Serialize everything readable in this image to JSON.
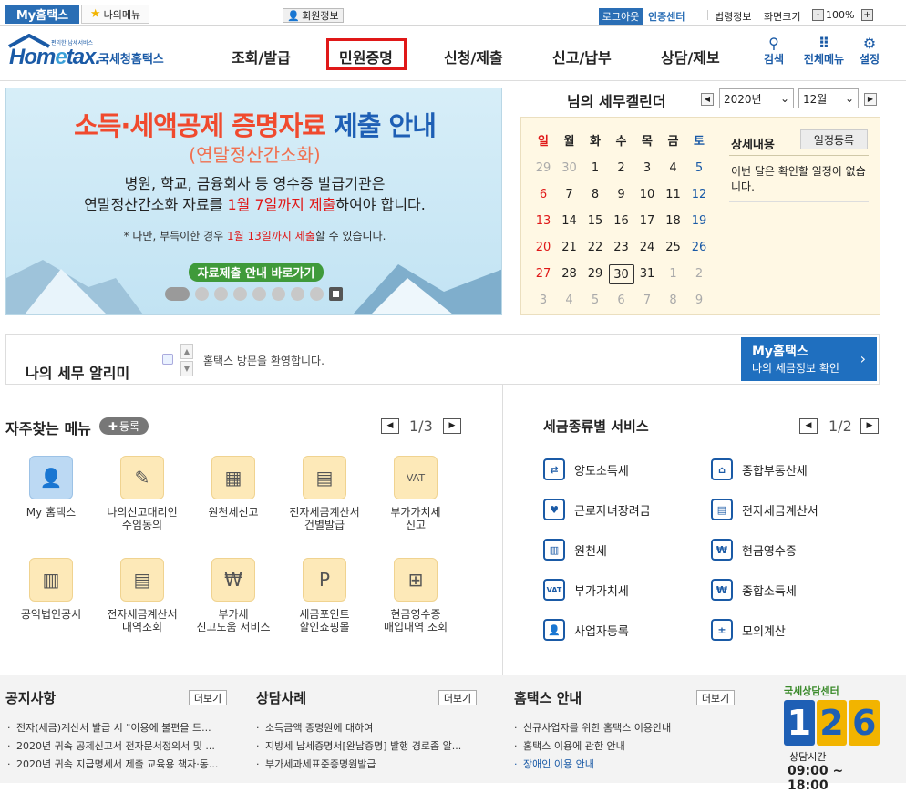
{
  "topbar": {
    "myhometax": "My홈택스",
    "mymenu": "나의메뉴",
    "member": "회원정보",
    "logout": "로그아웃",
    "cert": "인증센터",
    "law": "법령정보",
    "zoom_label": "화면크기",
    "zoom_minus": "-",
    "zoom_value": "100%",
    "zoom_plus": "+"
  },
  "header": {
    "logo_tiny": "편리한 납세서비스",
    "logo_brand_a": "Hom",
    "logo_brand_e": "e",
    "logo_brand_b": "tax.",
    "logo_sub": "국세청홈택스",
    "gnb": [
      "조회/발급",
      "민원증명",
      "신청/제출",
      "신고/납부",
      "상담/제보"
    ],
    "tools": [
      {
        "label": "검색",
        "icon": "search-icon"
      },
      {
        "label": "전체메뉴",
        "icon": "grid-icon"
      },
      {
        "label": "설정",
        "icon": "gear-icon"
      }
    ]
  },
  "banner": {
    "title_a": "소득·세액공제 증명자료",
    "title_b": "제출 안내",
    "subtitle": "(연말정산간소화)",
    "line1": "병원, 학교, 금융회사 등 영수증 발급기관은",
    "line2_a": "연말정산간소화 자료를 ",
    "line2_red": "1월 7일까지 제출",
    "line2_b": "하여야 합니다.",
    "note_a": "* 다만, 부득이한 경우 ",
    "note_red": "1월 13일까지 제출",
    "note_b": "할 수 있습니다.",
    "button": "자료제출 안내 바로가기"
  },
  "calendar": {
    "title": "님의 세무캘린더",
    "year": "2020년",
    "month": "12월",
    "weekdays": [
      "일",
      "월",
      "화",
      "수",
      "목",
      "금",
      "토"
    ],
    "weeks": [
      [
        "29",
        "30",
        "1",
        "2",
        "3",
        "4",
        "5"
      ],
      [
        "6",
        "7",
        "8",
        "9",
        "10",
        "11",
        "12"
      ],
      [
        "13",
        "14",
        "15",
        "16",
        "17",
        "18",
        "19"
      ],
      [
        "20",
        "21",
        "22",
        "23",
        "24",
        "25",
        "26"
      ],
      [
        "27",
        "28",
        "29",
        "30",
        "31",
        "1",
        "2"
      ],
      [
        "3",
        "4",
        "5",
        "6",
        "7",
        "8",
        "9"
      ]
    ],
    "today": "30",
    "detail_title": "상세내용",
    "schedule_button": "일정등록",
    "detail_text": "이번 달은 확인할 일정이 없습니다."
  },
  "notifier": {
    "title": "나의 세무 알리미",
    "message": "홈택스 방문을 환영합니다.",
    "box_title": "My홈택스",
    "box_sub": "나의 세금정보 확인"
  },
  "freq": {
    "title": "자주찾는 메뉴",
    "register": "등록",
    "page": "1/3",
    "items": [
      {
        "label": "My 홈택스",
        "icon": "user-icon"
      },
      {
        "label": "나의신고대리인\n수임동의",
        "icon": "document-pen-icon"
      },
      {
        "label": "원천세신고",
        "icon": "calendar-icon"
      },
      {
        "label": "전자세금계산서\n건별발급",
        "icon": "calculator-icon"
      },
      {
        "label": "부가가치세\n신고",
        "icon": "vat-icon"
      },
      {
        "label": "공익법인공시",
        "icon": "building-search-icon"
      },
      {
        "label": "전자세금계산서\n내역조회",
        "icon": "invoice-search-icon"
      },
      {
        "label": "부가세\n신고도움 서비스",
        "icon": "won-search-icon"
      },
      {
        "label": "세금포인트\n할인쇼핑몰",
        "icon": "point-bag-icon"
      },
      {
        "label": "현금영수증\n매입내역 조회",
        "icon": "receipt-search-icon"
      }
    ]
  },
  "tax": {
    "title": "세금종류별 서비스",
    "page": "1/2",
    "items": [
      {
        "label": "양도소득세",
        "icon": "transfer-icon"
      },
      {
        "label": "종합부동산세",
        "icon": "real-estate-icon"
      },
      {
        "label": "근로자녀장려금",
        "icon": "heart-icon"
      },
      {
        "label": "전자세금계산서",
        "icon": "invoice-icon"
      },
      {
        "label": "원천세",
        "icon": "withholding-icon"
      },
      {
        "label": "현금영수증",
        "icon": "cash-receipt-icon"
      },
      {
        "label": "부가가치세",
        "icon": "vat-icon"
      },
      {
        "label": "종합소득세",
        "icon": "money-bag-icon"
      },
      {
        "label": "사업자등록",
        "icon": "user-icon"
      },
      {
        "label": "모의계산",
        "icon": "calculator-icon"
      }
    ]
  },
  "bottom": {
    "notice": {
      "title": "공지사항",
      "more": "더보기",
      "items": [
        "전자(세금)계산서 발급 시 \"이용에 불편을 드...",
        "2020년 귀속 공제신고서 전자문서정의서 및 ...",
        "2020년 귀속 지급명세서 제출 교육용 책자·동..."
      ]
    },
    "cases": {
      "title": "상담사례",
      "more": "더보기",
      "items": [
        "소득금액 증명원에 대하여",
        "지방세 납세증명서[완납증명] 발행 경로좀 알...",
        "부가세과세표준증명원발급"
      ]
    },
    "guide": {
      "title": "홈택스 안내",
      "more": "더보기",
      "items": [
        "신규사업자를 위한 홈택스 이용안내",
        "홈택스 이용에 관한 안내",
        "장애인 이용 안내"
      ]
    },
    "center": {
      "title": "국세상담센터",
      "digits": [
        "1",
        "2",
        "6"
      ],
      "hours_label": "상담시간",
      "hours": "09:00 ~ 18:00"
    }
  },
  "colors": {
    "brand_blue": "#1a5aa6",
    "accent_red": "#e01818",
    "banner_green": "#3f9a3a"
  }
}
